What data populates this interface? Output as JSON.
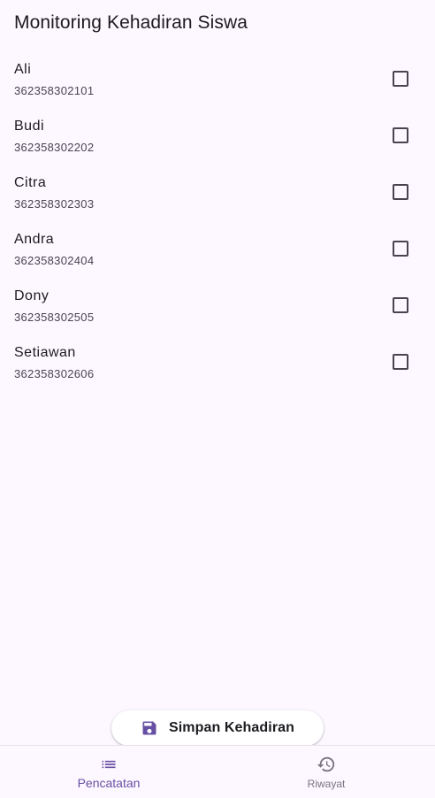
{
  "app": {
    "title": "Monitoring Kehadiran Siswa"
  },
  "students": [
    {
      "name": "Ali",
      "nim": "362358302101",
      "checked": false
    },
    {
      "name": "Budi",
      "nim": "362358302202",
      "checked": false
    },
    {
      "name": "Citra",
      "nim": "362358302303",
      "checked": false
    },
    {
      "name": "Andra",
      "nim": "362358302404",
      "checked": false
    },
    {
      "name": "Dony",
      "nim": "362358302505",
      "checked": false
    },
    {
      "name": "Setiawan",
      "nim": "362358302606",
      "checked": false
    }
  ],
  "save_button": {
    "label": "Simpan Kehadiran",
    "icon": "save-icon"
  },
  "bottom_nav": {
    "items": [
      {
        "label": "Pencatatan",
        "icon": "list-icon",
        "active": true
      },
      {
        "label": "Riwayat",
        "icon": "history-icon",
        "active": false
      }
    ]
  },
  "colors": {
    "background": "#fdf7ff",
    "accent": "#6750a4",
    "text": "#1d1b20",
    "secondary_text": "#49454f"
  }
}
